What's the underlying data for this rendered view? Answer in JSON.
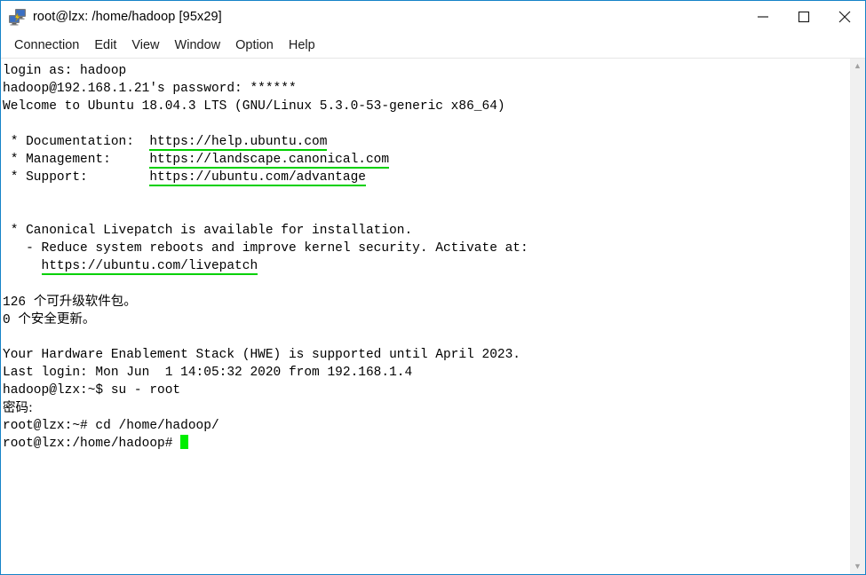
{
  "window": {
    "title": "root@lzx: /home/hadoop [95x29]",
    "icon": "terminal-connection-icon",
    "accent_color": "#1683c8",
    "controls": {
      "minimize": "minimize-button",
      "maximize": "maximize-button",
      "close": "close-button"
    }
  },
  "menubar": {
    "items": [
      {
        "label": "Connection"
      },
      {
        "label": "Edit"
      },
      {
        "label": "View"
      },
      {
        "label": "Window"
      },
      {
        "label": "Option"
      },
      {
        "label": "Help"
      }
    ]
  },
  "terminal": {
    "background_color": "#ffffff",
    "foreground_color": "#000000",
    "link_underline_color": "#00d000",
    "cursor_color": "#00ee00",
    "columns": 95,
    "rows": 29,
    "lines": [
      {
        "id": "l01",
        "text": "login as: hadoop"
      },
      {
        "id": "l02",
        "text": "hadoop@192.168.1.21's password: ******"
      },
      {
        "id": "l03",
        "text": "Welcome to Ubuntu 18.04.3 LTS (GNU/Linux 5.3.0-53-generic x86_64)"
      },
      {
        "id": "l04",
        "text": ""
      },
      {
        "id": "l05",
        "pre": " * Documentation:  ",
        "link": "https://help.ubuntu.com",
        "post": ""
      },
      {
        "id": "l06",
        "pre": " * Management:     ",
        "link": "https://landscape.canonical.com",
        "post": ""
      },
      {
        "id": "l07",
        "pre": " * Support:        ",
        "link": "https://ubuntu.com/advantage",
        "post": ""
      },
      {
        "id": "l08",
        "text": ""
      },
      {
        "id": "l09",
        "text": ""
      },
      {
        "id": "l10",
        "text": " * Canonical Livepatch is available for installation."
      },
      {
        "id": "l11",
        "text": "   - Reduce system reboots and improve kernel security. Activate at:"
      },
      {
        "id": "l12",
        "pre": "     ",
        "link": "https://ubuntu.com/livepatch",
        "post": ""
      },
      {
        "id": "l13",
        "text": ""
      },
      {
        "id": "l14",
        "prefix": "126 ",
        "cjk": "个可升级软件包。"
      },
      {
        "id": "l15",
        "prefix": "0 ",
        "cjk": "个安全更新。"
      },
      {
        "id": "l16",
        "text": ""
      },
      {
        "id": "l17",
        "text": "Your Hardware Enablement Stack (HWE) is supported until April 2023."
      },
      {
        "id": "l18",
        "text": "Last login: Mon Jun  1 14:05:32 2020 from 192.168.1.4"
      },
      {
        "id": "l19",
        "text": "hadoop@lzx:~$ su - root"
      },
      {
        "id": "l20",
        "prefix": "",
        "cjk": "密码:"
      },
      {
        "id": "l21",
        "text": "root@lzx:~# cd /home/hadoop/"
      },
      {
        "id": "l22",
        "text": "root@lzx:/home/hadoop# ",
        "cursor": true
      }
    ]
  },
  "scrollbar": {
    "up_arrow": "scroll-up-arrow",
    "down_arrow": "scroll-down-arrow",
    "up_glyph": "▲",
    "down_glyph": "▼"
  }
}
